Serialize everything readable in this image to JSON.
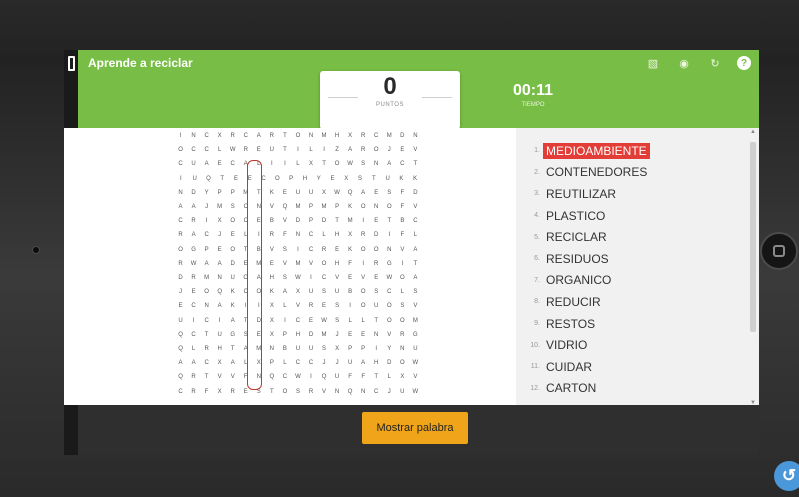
{
  "app": {
    "title": "Aprende a reciclar"
  },
  "toolbar": {
    "icons": [
      "image-icon",
      "share-icon",
      "restart-icon",
      "help-icon"
    ],
    "help_glyph": "?"
  },
  "score": {
    "value": "0",
    "label": "PUNTOS"
  },
  "timer": {
    "value": "00:11",
    "label": "TIEMPO"
  },
  "puzzle": {
    "rows": [
      "INCXRCARTONMHXRCMDN",
      "OCCLWREUTILIZAROJEV",
      "CUAECALIILXTOWSNACT",
      "IUQTEECOPHYEXSTUKK",
      "NDYPPMTKEUUXWQAESFD",
      "AAJMSCNVQMPMPKONOFV",
      "CRIXOCEBVDPDTMIETBC",
      "RACJELIRFNCLHXRDIFL",
      "OGPEOTBVSICREKOONVA",
      "RWAADEMEVMVOHFIRGIT",
      "DRMNUOAHSWICVEVEWOA",
      "JEOQKCOKAXUSUBOSCLS",
      "ECNAKIIXLVRESIOUOSV",
      "UICIATDXICEWSLLTOOM",
      "QCTUGSEXPHDMJEENVRG",
      "QLRHTAMNBUUSXPPIYNU",
      "AACXALXPLCCJJUAHDOW",
      "QRTVVFNQCWIQUFFTLXV",
      "CRFXRESTOSRVNQNCJUW"
    ]
  },
  "words": [
    {
      "num": "1.",
      "text": "MEDIOAMBIENTE",
      "found": true,
      "color": "#e23d36"
    },
    {
      "num": "2.",
      "text": "CONTENEDORES",
      "found": false
    },
    {
      "num": "3.",
      "text": "REUTILIZAR",
      "found": false
    },
    {
      "num": "4.",
      "text": "PLASTICO",
      "found": false
    },
    {
      "num": "5.",
      "text": "RECICLAR",
      "found": false
    },
    {
      "num": "6.",
      "text": "RESIDUOS",
      "found": false
    },
    {
      "num": "7.",
      "text": "ORGANICO",
      "found": false
    },
    {
      "num": "8.",
      "text": "REDUCIR",
      "found": false
    },
    {
      "num": "9.",
      "text": "RESTOS",
      "found": false
    },
    {
      "num": "10.",
      "text": "VIDRIO",
      "found": false
    },
    {
      "num": "11.",
      "text": "CUIDAR",
      "found": false
    },
    {
      "num": "12.",
      "text": "CARTON",
      "found": false
    }
  ],
  "actions": {
    "show_word_label": "Mostrar palabra"
  },
  "colors": {
    "header_green": "#78bd45",
    "button_orange": "#f0a419",
    "found_red": "#e23d36"
  }
}
